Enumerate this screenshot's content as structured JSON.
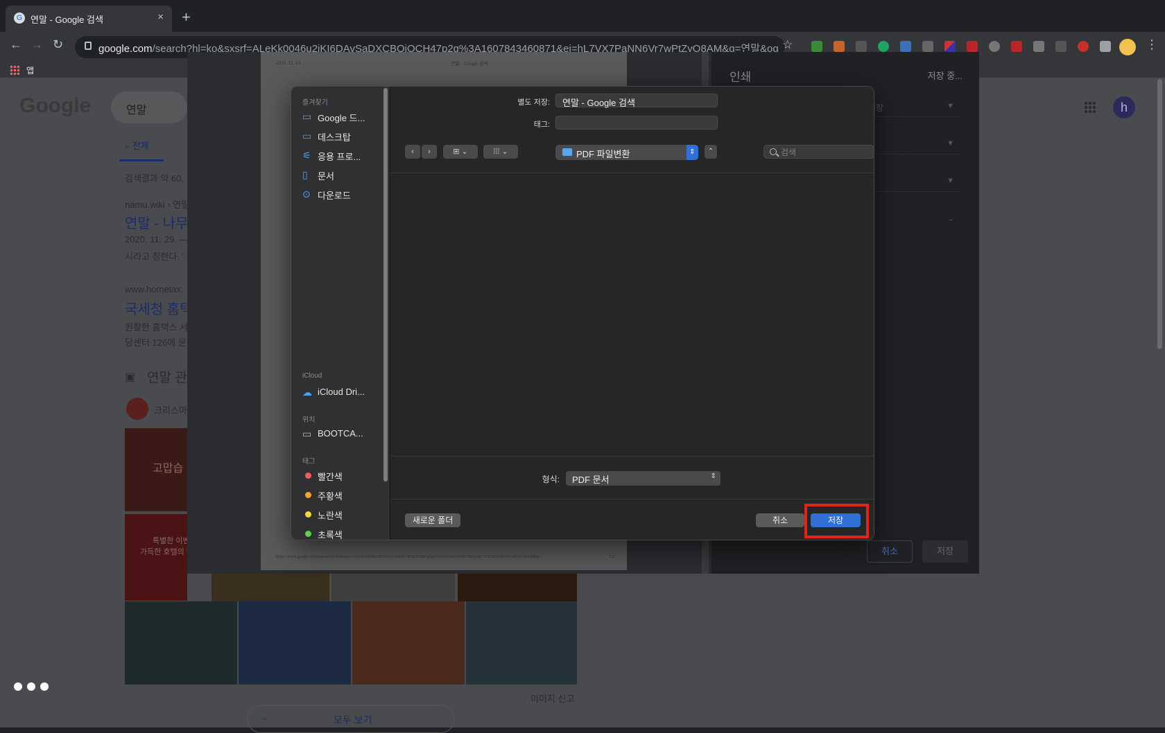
{
  "browser": {
    "tab_title": "연말 - Google 검색",
    "tab_close": "×",
    "new_tab": "+",
    "url_domain": "google.com",
    "url_rest": "/search?hl=ko&sxsrf=ALeKk0046u2jKI6DAvSaDXCBOjOCH47p2g%3A1607843460871&ei=hL7VX7PaNN6Vr7wPtZyO8AM&q=연말&oq...",
    "bookmarks_label": "앱",
    "back": "←",
    "forward": "→",
    "reload": "↻",
    "star": "☆",
    "menu": "⋮"
  },
  "google": {
    "logo": "Google",
    "query": "연말",
    "tab_all": "전체",
    "result_count": "검색결과 약 60,",
    "r1_site": "namu.wiki › 연말",
    "r1_title": "연말 - 나무",
    "r1_date": "2020. 11. 29. —",
    "r1_snip": "시라고 칭한다. '",
    "r2_site": "www.hometax.",
    "r2_title": "국세청 홈택",
    "r2_snip1": "원활한 홈택스 서",
    "r2_snip2": "담센터 126에 문",
    "images_heading": "연말 관",
    "chip": "크리스마",
    "img_text1": "고맙습",
    "img_text2": "특별한 이벤트",
    "img_text3": "가득한 호텔의 연",
    "report_images": "이미지 신고",
    "see_all": "모두 보기",
    "avatar": "h"
  },
  "print": {
    "preview_date": "2020. 12. 13.",
    "preview_title": "연말 - Google 검색",
    "preview_footer": "https://www.google.com/search?hl=ko&sxsrf=ALeKk0046u2jKI6DAvSaDXCBOjOCH47p2g%3A1607843460871&ei=hL7VX7PaNN6Vr7wPtZyO8AM&q=...",
    "preview_page_num": "1/2",
    "title": "인쇄",
    "status": "저장 중...",
    "dest_value": "저장",
    "cancel": "취소",
    "save": "저장"
  },
  "dialog": {
    "save_as_label": "별도 저장:",
    "save_as_value": "연말 - Google 검색",
    "tags_label": "태그:",
    "folder": "PDF 파일변환",
    "search_placeholder": "검색",
    "format_label": "형식:",
    "format_value": "PDF 문서",
    "new_folder": "새로운 폴더",
    "cancel": "취소",
    "save": "저장",
    "sidebar": {
      "favorites_head": "즐겨찾기",
      "favorites": [
        "Google 드...",
        "데스크탑",
        "응용 프로...",
        "문서",
        "다운로드"
      ],
      "icloud_head": "iCloud",
      "icloud_drive": "iCloud Dri...",
      "locations_head": "위치",
      "bootcamp": "BOOTCA...",
      "tags_head": "태그",
      "tags": [
        {
          "label": "빨간색",
          "color": "#ec5f5b"
        },
        {
          "label": "주황색",
          "color": "#f4a13c"
        },
        {
          "label": "노란색",
          "color": "#f5d63d"
        },
        {
          "label": "초록색",
          "color": "#5fcf4c"
        }
      ]
    }
  },
  "colors": {
    "accent": "#2f6fd6",
    "highlight": "#e1251b"
  }
}
